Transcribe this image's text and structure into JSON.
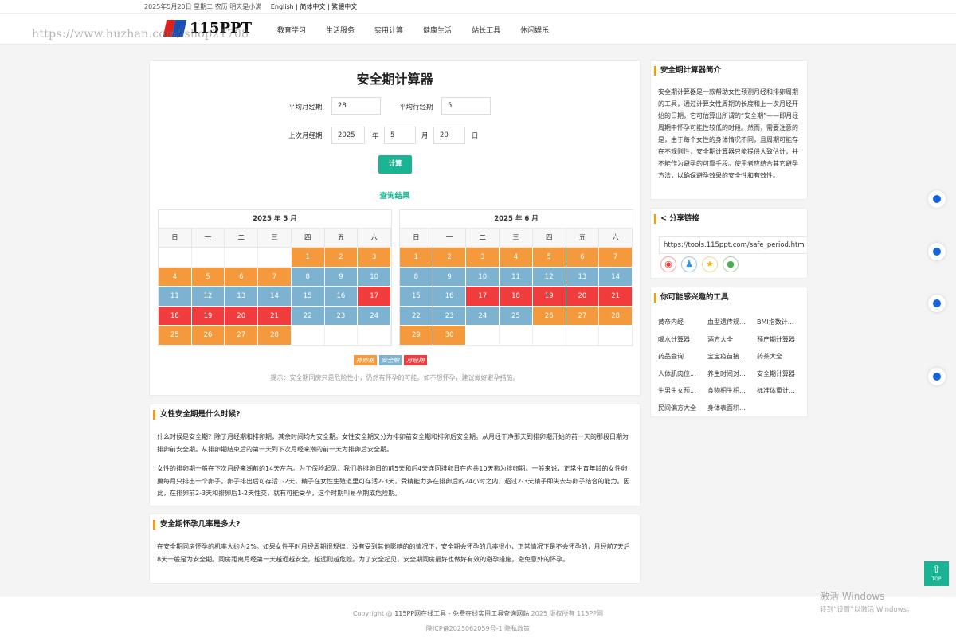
{
  "topbar": {
    "date": "2025年5月20日 星期二 农历 明天是小满",
    "langs": "English | 简体中文 | 繁體中文"
  },
  "logo": {
    "text": "115PPT"
  },
  "watermark": "https://www.huzhan.com/ishop21708",
  "nav": [
    "教育学习",
    "生活服务",
    "实用计算",
    "健康生活",
    "站长工具",
    "休闲娱乐"
  ],
  "calc": {
    "title": "安全期计算器",
    "avg_cycle_label": "平均月经期",
    "avg_cycle_value": "28",
    "avg_period_label": "平均行经期",
    "avg_period_value": "5",
    "last_label": "上次月经期",
    "year_value": "2025",
    "year_unit": "年",
    "month_value": "5",
    "month_unit": "月",
    "day_value": "20",
    "day_unit": "日",
    "button": "计算",
    "result_title": "查询结果",
    "weekdays": [
      "日",
      "一",
      "二",
      "三",
      "四",
      "五",
      "六"
    ],
    "may": {
      "title": "2025 年 5 月",
      "offset": 4,
      "days": [
        "o",
        "o",
        "o",
        "o",
        "o",
        "o",
        "o",
        "b",
        "b",
        "b",
        "b",
        "b",
        "b",
        "b",
        "b",
        "b",
        "r",
        "r",
        "r",
        "r",
        "r",
        "b",
        "b",
        "b",
        "o",
        "o",
        "o",
        "o"
      ]
    },
    "june": {
      "title": "2025 年 6 月",
      "offset": 0,
      "days": [
        "o",
        "o",
        "o",
        "o",
        "o",
        "o",
        "o",
        "b",
        "b",
        "b",
        "b",
        "b",
        "b",
        "b",
        "b",
        "b",
        "r",
        "r",
        "r",
        "r",
        "r",
        "b",
        "b",
        "b",
        "b",
        "o",
        "o",
        "o",
        "o",
        "o"
      ]
    },
    "legend": {
      "ovulation": "排卵期",
      "safe": "安全期",
      "menstrual": "月经期"
    },
    "tip": "提示：安全期同房只是危险性小，仍然有怀孕的可能。如不想怀孕，建议做好避孕措施。"
  },
  "colors": {
    "o": "#f59a3c",
    "b": "#7db3d0",
    "r": "#f03c3c",
    "accent": "#1ab394"
  },
  "article1": {
    "title": "女性安全期是什么时候?",
    "p1": "什么时候是安全期？除了月经期和排卵期，其余时间均为安全期。女性安全期又分为排卵前安全期和排卵后安全期。从月经干净那天到排卵期开始的前一天的那段日期为排卵前安全期。从排卵期结束后的第一天到下次月经来潮的前一天为排卵后安全期。",
    "p2": "女性的排卵期一般在下次月经来潮前的14天左右。为了保险起见，我们将排卵日的前5天和后4天连同排卵日在内共10天称为排卵期。一般来说，正常生育年龄的女性卵巢每月只排出一个卵子。卵子排出后可存活1-2天，精子在女性生殖道里可存活2-3天，受精能力多在排卵后的24小时之内，超过2-3天精子即失去与卵子结合的能力。因此，在排卵前2-3天和排卵后1-2天性交，就有可能受孕，这个时期叫易孕期或危险期。"
  },
  "article2": {
    "title": "安全期怀孕几率是多大?",
    "p1": "在安全期同房怀孕的机率大约为2%。如果女性平时月经周期很规律，没有受到其他影响的的情况下，安全期会怀孕的几率很小，正常情况下是不会怀孕的，月经前7天后8天一般是为安全期。同房距离月经第一天越近越安全，越远则越危险。为了安全起见，安全期同房最好也做好有效的避孕措施，避免意外的怀孕。"
  },
  "side": {
    "intro_title": "安全期计算器简介",
    "intro_text": "安全期计算器是一款帮助女性预测月经和排卵周期的工具，通过计算女性周期的长度和上一次月经开始的日期，它可估算出所谓的“安全期”——即月经周期中怀孕可能性较低的时段。然而，需要注意的是，由于每个女性的身体情况不同，且周期可能存在不规则性，安全期计算器只能提供大致估计，并不能作为避孕的可靠手段。使用者应结合其它避孕方法，以确保避孕效果的安全性和有效性。",
    "share_title": "分享链接",
    "share_url": "https://tools.115ppt.com/safe_period.htm",
    "tools_title": "你可能感兴趣的工具",
    "tools": [
      "黄帝内经",
      "血型遗传规...",
      "BMI指数计...",
      "喝水计算器",
      "酒方大全",
      "预产期计算器",
      "药品查询",
      "宝宝疫苗接...",
      "药茶大全",
      "人体肌肉位...",
      "养生时间对...",
      "安全期计算器",
      "生男生女预...",
      "食物相生相...",
      "标准体重计...",
      "民间偏方大全",
      "身体表面积..."
    ]
  },
  "top_button": "TOP",
  "footer": {
    "line1_a": "Copyright @ ",
    "line1_b": "115PP网在线工具 - 免费在线实用工具查询网站",
    "line1_c": " 2025 版权所有 115PP网",
    "line2": "陕ICP备2025062059号-1 隐私政策"
  },
  "windows": {
    "line1": "激活 Windows",
    "line2": "转到“设置”以激活 Windows。"
  }
}
